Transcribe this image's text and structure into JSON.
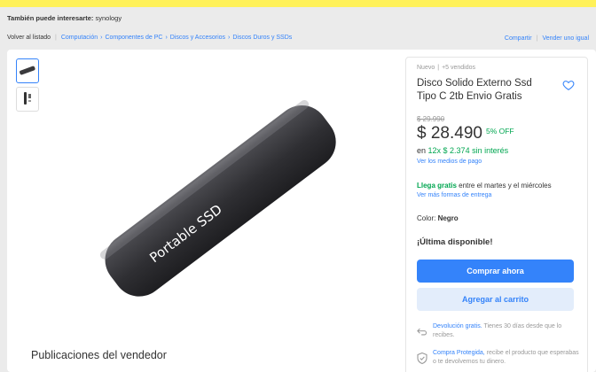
{
  "header": {
    "related_label": "También puede interesarte:",
    "related_term": "synology"
  },
  "breadcrumb": {
    "back": "Volver al listado",
    "path": [
      "Computación",
      "Componentes de PC",
      "Discos y Accesorios",
      "Discos Duros y SSDs"
    ],
    "share": "Compartir",
    "sell": "Vender uno igual"
  },
  "gallery": {
    "image_label": "Portable SSD"
  },
  "product": {
    "condition": "Nuevo",
    "sold": "+5 vendidos",
    "title": "Disco Solido Externo Ssd Tipo C 2tb Envio Gratis",
    "original_price": "$ 29.990",
    "price": "$ 28.490",
    "discount": "5% OFF",
    "installments_prefix": "en",
    "installments": "12x $ 2.374 sin interés",
    "payment_link": "Ver los medios de pago",
    "shipping_highlight": "Llega gratis",
    "shipping_text": " entre el martes y el miércoles",
    "shipping_link": "Ver más formas de entrega",
    "color_label": "Color: ",
    "color_value": "Negro",
    "stock": "¡Última disponible!",
    "buy_button": "Comprar ahora",
    "cart_button": "Agregar al carrito",
    "return_link": "Devolución gratis.",
    "return_text": " Tienes 30 días desde que lo recibes.",
    "protect_link": "Compra Protegida,",
    "protect_text": " recibe el producto que esperabas o te devolvemos tu dinero."
  },
  "seller": {
    "title": "Publicaciones del vendedor"
  },
  "colors": {
    "brand_yellow": "#fff159",
    "accent_blue": "#3483fa",
    "success_green": "#00a650"
  }
}
